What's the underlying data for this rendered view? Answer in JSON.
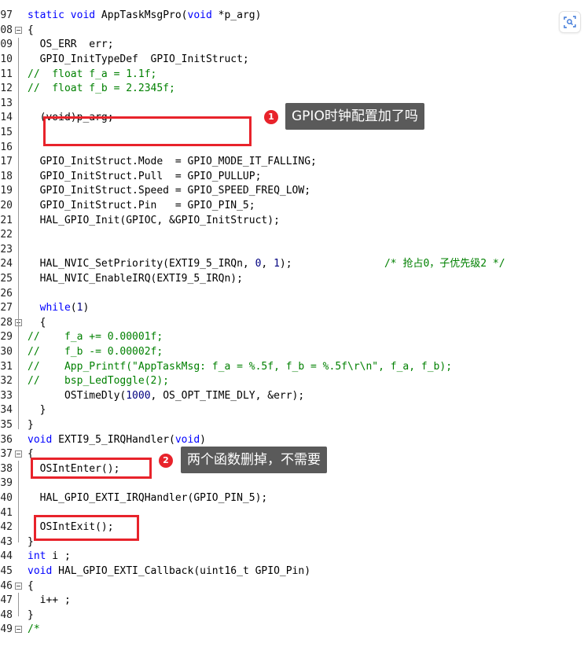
{
  "editor": {
    "lines": [
      {
        "no": "",
        "fold": false,
        "segs": []
      },
      {
        "no": "97",
        "fold": false,
        "segs": [
          {
            "t": "static void ",
            "c": "kw"
          },
          {
            "t": "AppTaskMsgPro(",
            "c": ""
          },
          {
            "t": "void",
            "c": "kw"
          },
          {
            "t": " *p_arg)",
            "c": ""
          }
        ]
      },
      {
        "no": "08",
        "fold": true,
        "segs": [
          {
            "t": "{",
            "c": ""
          }
        ]
      },
      {
        "no": "09",
        "fold": false,
        "segs": [
          {
            "t": "  OS_ERR  err;",
            "c": ""
          }
        ]
      },
      {
        "no": "10",
        "fold": false,
        "segs": [
          {
            "t": "  GPIO_InitTypeDef  GPIO_InitStruct;",
            "c": ""
          }
        ]
      },
      {
        "no": "11",
        "fold": false,
        "segs": [
          {
            "t": "//  float f_a = 1.1f;",
            "c": "cm"
          }
        ]
      },
      {
        "no": "12",
        "fold": false,
        "segs": [
          {
            "t": "//  float f_b = 2.2345f;",
            "c": "cm"
          }
        ]
      },
      {
        "no": "13",
        "fold": false,
        "segs": []
      },
      {
        "no": "14",
        "fold": false,
        "segs": [
          {
            "t": "  (void)p_arg;",
            "c": ""
          }
        ]
      },
      {
        "no": "15",
        "fold": false,
        "segs": []
      },
      {
        "no": "16",
        "fold": false,
        "segs": []
      },
      {
        "no": "17",
        "fold": false,
        "segs": [
          {
            "t": "  GPIO_InitStruct.Mode  = GPIO_MODE_IT_FALLING;",
            "c": ""
          }
        ]
      },
      {
        "no": "18",
        "fold": false,
        "segs": [
          {
            "t": "  GPIO_InitStruct.Pull  = GPIO_PULLUP;",
            "c": ""
          }
        ]
      },
      {
        "no": "19",
        "fold": false,
        "segs": [
          {
            "t": "  GPIO_InitStruct.Speed = GPIO_SPEED_FREQ_LOW;",
            "c": ""
          }
        ]
      },
      {
        "no": "20",
        "fold": false,
        "segs": [
          {
            "t": "  GPIO_InitStruct.Pin   = GPIO_PIN_5;",
            "c": ""
          }
        ]
      },
      {
        "no": "21",
        "fold": false,
        "segs": [
          {
            "t": "  HAL_GPIO_Init(GPIOC, &GPIO_InitStruct);",
            "c": ""
          }
        ]
      },
      {
        "no": "22",
        "fold": false,
        "segs": []
      },
      {
        "no": "23",
        "fold": false,
        "segs": []
      },
      {
        "no": "24",
        "fold": false,
        "segs": [
          {
            "t": "  HAL_NVIC_SetPriority(EXTI9_5_IRQn, ",
            "c": ""
          },
          {
            "t": "0",
            "c": "num"
          },
          {
            "t": ", ",
            "c": ""
          },
          {
            "t": "1",
            "c": "num"
          },
          {
            "t": ");               ",
            "c": ""
          },
          {
            "t": "/* 抢占0，子优先级2 */",
            "c": "cm"
          }
        ]
      },
      {
        "no": "25",
        "fold": false,
        "segs": [
          {
            "t": "  HAL_NVIC_EnableIRQ(EXTI9_5_IRQn);",
            "c": ""
          }
        ]
      },
      {
        "no": "26",
        "fold": false,
        "segs": []
      },
      {
        "no": "27",
        "fold": false,
        "segs": [
          {
            "t": "  ",
            "c": ""
          },
          {
            "t": "while",
            "c": "kw"
          },
          {
            "t": "(",
            "c": ""
          },
          {
            "t": "1",
            "c": "num"
          },
          {
            "t": ")",
            "c": ""
          }
        ]
      },
      {
        "no": "28",
        "fold": true,
        "segs": [
          {
            "t": "  {",
            "c": ""
          }
        ]
      },
      {
        "no": "29",
        "fold": false,
        "segs": [
          {
            "t": "//    f_a += 0.00001f;",
            "c": "cm"
          }
        ]
      },
      {
        "no": "30",
        "fold": false,
        "segs": [
          {
            "t": "//    f_b -= 0.00002f;",
            "c": "cm"
          }
        ]
      },
      {
        "no": "31",
        "fold": false,
        "segs": [
          {
            "t": "//    App_Printf(\"AppTaskMsg: f_a = %.5f, f_b = %.5f\\r\\n\", f_a, f_b);",
            "c": "cm"
          }
        ]
      },
      {
        "no": "32",
        "fold": false,
        "segs": [
          {
            "t": "//    bsp_LedToggle(2);",
            "c": "cm"
          }
        ]
      },
      {
        "no": "33",
        "fold": false,
        "segs": [
          {
            "t": "      OSTimeDly(",
            "c": ""
          },
          {
            "t": "1000",
            "c": "num"
          },
          {
            "t": ", OS_OPT_TIME_DLY, &err);",
            "c": ""
          }
        ]
      },
      {
        "no": "34",
        "fold": false,
        "segs": [
          {
            "t": "  }",
            "c": ""
          }
        ]
      },
      {
        "no": "35",
        "fold": false,
        "segs": [
          {
            "t": "}",
            "c": ""
          }
        ]
      },
      {
        "no": "36",
        "fold": false,
        "segs": [
          {
            "t": "void",
            "c": "kw"
          },
          {
            "t": " EXTI9_5_IRQHandler(",
            "c": ""
          },
          {
            "t": "void",
            "c": "kw"
          },
          {
            "t": ")",
            "c": ""
          }
        ]
      },
      {
        "no": "37",
        "fold": true,
        "segs": [
          {
            "t": "{",
            "c": ""
          }
        ]
      },
      {
        "no": "38",
        "fold": false,
        "segs": [
          {
            "t": "  OSIntEnter();",
            "c": ""
          }
        ]
      },
      {
        "no": "39",
        "fold": false,
        "segs": []
      },
      {
        "no": "40",
        "fold": false,
        "segs": [
          {
            "t": "  HAL_GPIO_EXTI_IRQHandler(GPIO_PIN_5);",
            "c": ""
          }
        ]
      },
      {
        "no": "41",
        "fold": false,
        "segs": []
      },
      {
        "no": "42",
        "fold": false,
        "segs": [
          {
            "t": "  OSIntExit();",
            "c": ""
          }
        ]
      },
      {
        "no": "43",
        "fold": false,
        "segs": [
          {
            "t": "}",
            "c": ""
          }
        ]
      },
      {
        "no": "44",
        "fold": false,
        "segs": [
          {
            "t": "int",
            "c": "kw"
          },
          {
            "t": " i ;",
            "c": ""
          }
        ]
      },
      {
        "no": "45",
        "fold": false,
        "segs": [
          {
            "t": "void",
            "c": "kw"
          },
          {
            "t": " HAL_GPIO_EXTI_Callback(uint16_t GPIO_Pin)",
            "c": ""
          }
        ]
      },
      {
        "no": "46",
        "fold": true,
        "segs": [
          {
            "t": "{",
            "c": ""
          }
        ]
      },
      {
        "no": "47",
        "fold": false,
        "segs": [
          {
            "t": "  i++ ;",
            "c": ""
          }
        ]
      },
      {
        "no": "48",
        "fold": false,
        "segs": [
          {
            "t": "}",
            "c": ""
          }
        ]
      },
      {
        "no": "49",
        "fold": true,
        "segs": [
          {
            "t": "/*",
            "c": "cm"
          }
        ]
      }
    ]
  },
  "annotations": {
    "callout1": {
      "number": "1",
      "text": "GPIO时钟配置加了吗"
    },
    "callout2": {
      "number": "2",
      "text": "两个函数删掉，不需要"
    }
  },
  "colors": {
    "highlight_red": "#e8232b",
    "callout_bg": "#5a5a5a",
    "keyword": "#0000ff",
    "comment": "#008000"
  },
  "toolbar": {
    "icon": "scan-search-icon"
  }
}
